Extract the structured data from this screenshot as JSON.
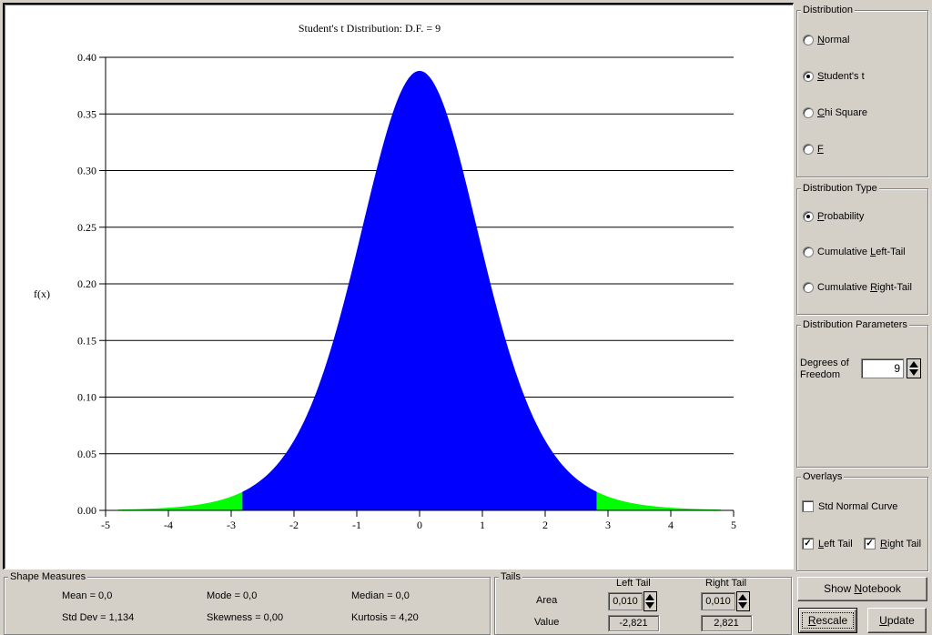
{
  "chart_data": {
    "type": "area",
    "title": "Student's t Distribution: D.F. = 9",
    "xlabel": "",
    "ylabel": "f(x)",
    "distribution": "Student's t",
    "degrees_of_freedom": 9,
    "xlim": [
      -5,
      5
    ],
    "ylim": [
      0,
      0.4
    ],
    "x_ticks": [
      "-5",
      "-4",
      "-3",
      "-2",
      "-1",
      "0",
      "1",
      "2",
      "3",
      "4",
      "5"
    ],
    "x_tick_values": [
      -5,
      -4,
      -3,
      -2,
      -1,
      0,
      1,
      2,
      3,
      4,
      5
    ],
    "y_ticks": [
      "0.00",
      "0.05",
      "0.10",
      "0.15",
      "0.20",
      "0.25",
      "0.30",
      "0.35",
      "0.40"
    ],
    "y_tick_values": [
      0,
      0.05,
      0.1,
      0.15,
      0.2,
      0.25,
      0.3,
      0.35,
      0.4
    ],
    "grid": "horizontal",
    "curve_range": [
      -4.8,
      4.8
    ],
    "peak_value": 0.388,
    "regions": [
      {
        "name": "left-tail",
        "from": -4.8,
        "to": -2.821,
        "color": "#00ff00"
      },
      {
        "name": "body",
        "from": -2.821,
        "to": 2.821,
        "color": "#0000ff"
      },
      {
        "name": "right-tail",
        "from": 2.821,
        "to": 4.8,
        "color": "#00ff00"
      }
    ]
  },
  "sidebar": {
    "distribution": {
      "title": "Distribution",
      "options": [
        {
          "pre": "",
          "u": "N",
          "post": "ormal",
          "selected": false
        },
        {
          "pre": "",
          "u": "S",
          "post": "tudent's t",
          "selected": true
        },
        {
          "pre": "",
          "u": "C",
          "post": "hi Square",
          "selected": false
        },
        {
          "pre": "",
          "u": "F",
          "post": "",
          "selected": false
        }
      ]
    },
    "distribution_type": {
      "title": "Distribution Type",
      "options": [
        {
          "pre": "",
          "u": "P",
          "post": "robability",
          "selected": true
        },
        {
          "pre": "Cumulative ",
          "u": "L",
          "post": "eft-Tail",
          "selected": false
        },
        {
          "pre": "Cumulative ",
          "u": "R",
          "post": "ight-Tail",
          "selected": false
        }
      ]
    },
    "parameters": {
      "title": "Distribution Parameters",
      "dof_label_1": "Degrees of",
      "dof_label_2": "Freedom",
      "dof_value": "9"
    },
    "overlays": {
      "title": "Overlays",
      "std_normal": {
        "label": "Std Normal Curve",
        "checked": false
      },
      "left_tail": {
        "u": "L",
        "post": "eft Tail",
        "checked": true
      },
      "right_tail": {
        "u": "R",
        "post": "ight Tail",
        "checked": true
      }
    },
    "buttons": {
      "show_notebook_pre": "Show ",
      "show_notebook_u": "N",
      "show_notebook_post": "otebook",
      "rescale_u": "R",
      "rescale_post": "escale",
      "update_u": "U",
      "update_post": "pdate"
    }
  },
  "shape_measures": {
    "title": "Shape Measures",
    "mean": "Mean = 0,0",
    "mode": "Mode = 0,0",
    "median": "Median = 0,0",
    "std_dev": "Std Dev = 1,134",
    "skewness": "Skewness = 0,00",
    "kurtosis": "Kurtosis = 4,20"
  },
  "tails": {
    "title": "Tails",
    "left_header": "Left Tail",
    "right_header": "Right Tail",
    "area_label": "Area",
    "value_label": "Value",
    "left_area": "0,010",
    "right_area": "0,010",
    "left_value": "-2,821",
    "right_value": "2,821"
  }
}
